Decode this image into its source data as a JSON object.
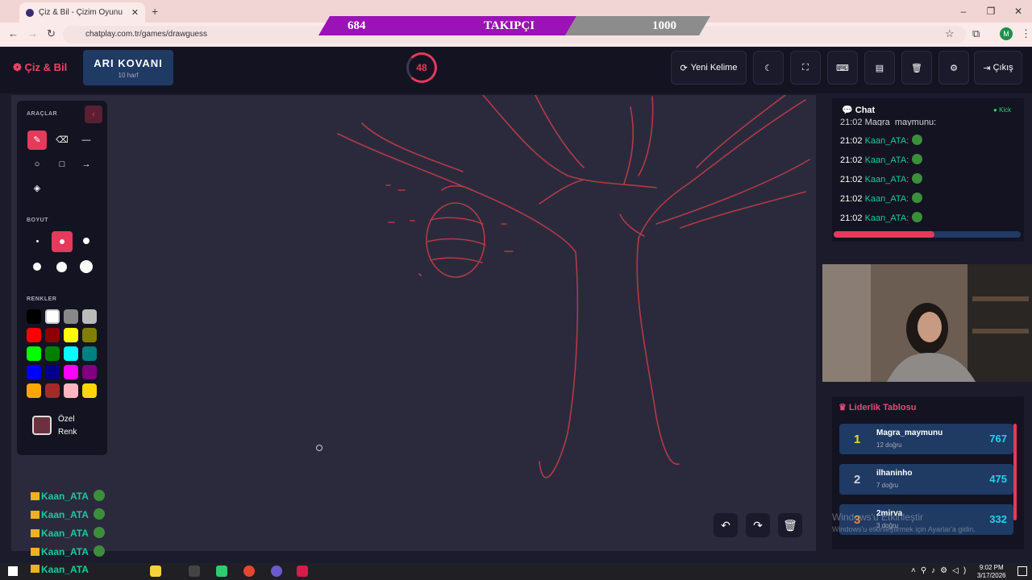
{
  "browser": {
    "tab_title": "Çiz & Bil - Çizim Oyunu",
    "new_tab": "+",
    "tab_close": "✕",
    "url": "chatplay.com.tr/games/drawguess",
    "profile_initial": "M",
    "window_controls": [
      "–",
      "❐",
      "✕"
    ]
  },
  "follower_goal": {
    "current": "684",
    "label": "TAKIPÇI",
    "target": "1000"
  },
  "game": {
    "logo": "Çiz & Bil",
    "word": "ARI KOVANI",
    "word_length": "10 harf",
    "timer": "48"
  },
  "header_buttons": {
    "new_word": "Yeni Kelime",
    "logout": "Çıkış"
  },
  "tools": {
    "title": "ARAÇLAR",
    "size_title": "BOYUT",
    "colors_title": "RENKLER",
    "custom_color_label_1": "Özel",
    "custom_color_label_2": "Renk",
    "palette": [
      "#000000",
      "#ffffff",
      "#888888",
      "#bbbbbb",
      "#ff0000",
      "#8b0000",
      "#ffff00",
      "#808000",
      "#00ff00",
      "#008000",
      "#00ffff",
      "#008080",
      "#0000ff",
      "#00008b",
      "#ff00ff",
      "#800080",
      "#ffa500",
      "#a52a2a",
      "#ffb6c1",
      "#ffd700"
    ],
    "custom_color": "#6e3040"
  },
  "guess_feed": {
    "items": [
      "Kaan_ATA",
      "Kaan_ATA",
      "Kaan_ATA",
      "Kaan_ATA"
    ]
  },
  "chat": {
    "title": "Chat",
    "kick": "Kick",
    "partial_top": "21:02 Magra_maymunu:",
    "messages": [
      {
        "time": "21:02",
        "user": "Kaan_ATA:"
      },
      {
        "time": "21:02",
        "user": "Kaan_ATA:"
      },
      {
        "time": "21:02",
        "user": "Kaan_ATA:"
      },
      {
        "time": "21:02",
        "user": "Kaan_ATA:"
      },
      {
        "time": "21:02",
        "user": "Kaan_ATA:"
      }
    ],
    "progress": 0.54
  },
  "leaderboard": {
    "title": "Liderlik Tablosu",
    "rows": [
      {
        "rank": "1",
        "name": "Magra_maymunu",
        "correct": "12 doğru",
        "points": "767"
      },
      {
        "rank": "2",
        "name": "ilhaninho",
        "correct": "7 doğru",
        "points": "475"
      },
      {
        "rank": "3",
        "name": "2mirva",
        "correct": "3 doğru",
        "points": "332"
      }
    ]
  },
  "watermark": {
    "line1": "Windows'u Etkinleştir",
    "line2": "Windows'u etkinleştirmek için Ayarlar'a gidin."
  },
  "taskbar": {
    "user": "Kaan_ATA",
    "time": "9:02 PM",
    "date": "3/17/2026"
  },
  "colors": {
    "accent": "#e43a5c",
    "teal": "#1ec8a0",
    "panel": "#141321",
    "canvas": "#2b2a3d",
    "drawing": "#b23a45"
  }
}
